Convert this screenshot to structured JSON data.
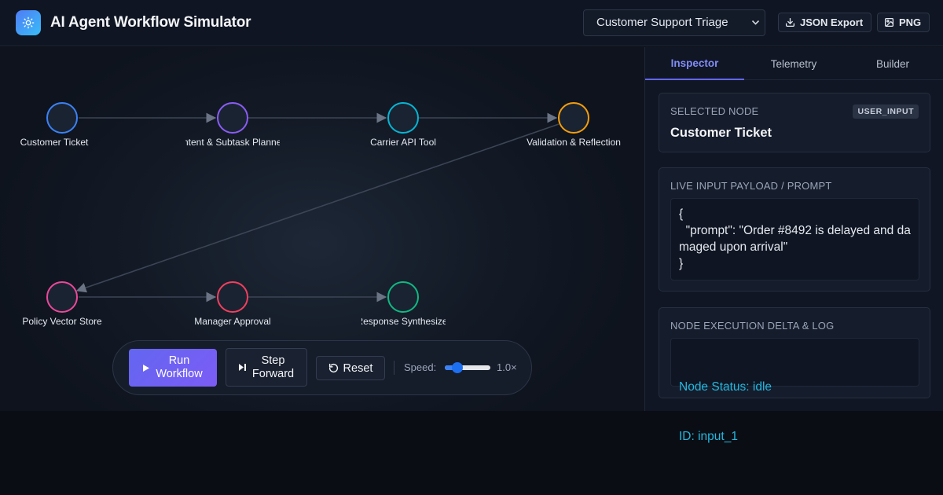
{
  "header": {
    "title": "AI Agent Workflow Simulator",
    "scenario": "Customer Support Triage",
    "json_export": "JSON Export",
    "png_export": "PNG"
  },
  "workflow": {
    "nodes": [
      {
        "label": "Customer Ticket",
        "color": "#3b82f6"
      },
      {
        "label": "Intent & Subtask Planner",
        "color": "#8b5cf6"
      },
      {
        "label": "Carrier API Tool",
        "color": "#06b6d4"
      },
      {
        "label": "Validation & Reflection",
        "color": "#f59e0b"
      },
      {
        "label": "Policy Vector Store",
        "color": "#ec4899"
      },
      {
        "label": "Manager Approval",
        "color": "#f43f5e"
      },
      {
        "label": "Response Synthesizer",
        "color": "#10b981"
      }
    ]
  },
  "controls": {
    "run_line1": "Run",
    "run_line2": "Workflow",
    "step_line1": "Step",
    "step_line2": "Forward",
    "reset": "Reset",
    "speed_label": "Speed:",
    "speed_value": "1.0×",
    "speed_level": 0.2
  },
  "panel": {
    "tabs": [
      "Inspector",
      "Telemetry",
      "Builder"
    ],
    "selected": {
      "title": "SELECTED NODE",
      "badge": "USER_INPUT",
      "name": "Customer Ticket"
    },
    "payload": {
      "title": "LIVE INPUT PAYLOAD / PROMPT",
      "content": "{\n  \"prompt\": \"Order #8492 is delayed and damaged upon arrival\"\n}"
    },
    "log": {
      "title": "NODE EXECUTION DELTA & LOG",
      "status": "Node Status: idle",
      "id": "ID: input_1"
    }
  }
}
